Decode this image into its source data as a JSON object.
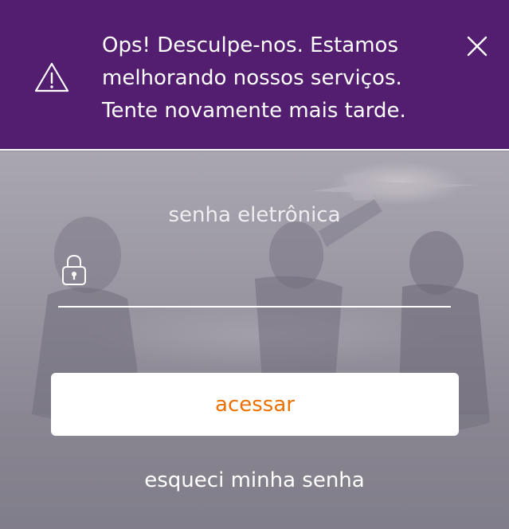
{
  "colors": {
    "banner_bg": "#531e6f",
    "accent": "#ec7000",
    "text_light": "#ffffff"
  },
  "banner": {
    "icon": "warning-icon",
    "message": "Ops! Desculpe-nos. Estamos melhorando nossos serviços. Tente novamente mais tarde.",
    "close_icon": "close-icon"
  },
  "login": {
    "password_label": "senha eletrônica",
    "lock_icon": "lock-icon",
    "password_value": "",
    "submit_label": "acessar",
    "forgot_label": "esqueci minha senha"
  }
}
